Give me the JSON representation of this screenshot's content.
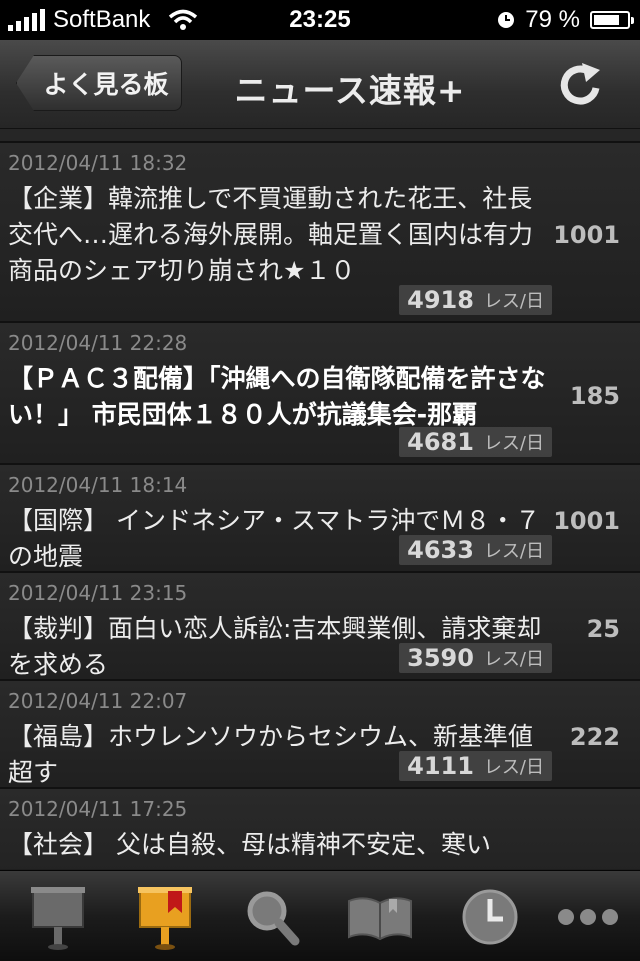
{
  "status_bar": {
    "carrier": "SoftBank",
    "time": "23:25",
    "battery": "79 %",
    "battery_level": 0.79
  },
  "nav": {
    "back_label": "よく見る板",
    "title": "ニュース速報+",
    "refresh_icon": "refresh-icon"
  },
  "threads": [
    {
      "date": "2012/04/11 18:32",
      "title": "【企業】韓流推しで不買運動された花王、社長交代へ…遅れる海外展開。軸足置く国内は有力商品のシェア切り崩され★１０",
      "rate": "4918",
      "count": "1001",
      "bold": false
    },
    {
      "date": "2012/04/11 22:28",
      "title": "【ＰＡＣ３配備】「沖縄への自衛隊配備を許さない！」 市民団体１８０人が抗議集会-那覇",
      "rate": "4681",
      "count": "185",
      "bold": true
    },
    {
      "date": "2012/04/11 18:14",
      "title": "【国際】 インドネシア・スマトラ沖でＭ８・７の地震",
      "rate": "4633",
      "count": "1001",
      "bold": false
    },
    {
      "date": "2012/04/11 23:15",
      "title": "【裁判】面白い恋人訴訟:吉本興業側、請求棄却を求める",
      "rate": "3590",
      "count": "25",
      "bold": false
    },
    {
      "date": "2012/04/11 22:07",
      "title": "【福島】ホウレンソウからセシウム、新基準値超す",
      "rate": "4111",
      "count": "222",
      "bold": false
    },
    {
      "date": "2012/04/11 17:25",
      "title": "【社会】 父は自殺、母は精神不安定、寒い",
      "rate": "",
      "count": "",
      "bold": false
    }
  ],
  "rate_unit": "レス/日",
  "tabbar": {
    "tabs": [
      {
        "icon": "board-sign-icon",
        "selected": false
      },
      {
        "icon": "bookmark-board-icon",
        "selected": true
      },
      {
        "icon": "search-icon",
        "selected": false
      },
      {
        "icon": "book-icon",
        "selected": false
      },
      {
        "icon": "clock-icon",
        "selected": false
      },
      {
        "icon": "more-icon",
        "selected": false
      }
    ]
  },
  "colors": {
    "background": "#1e1e1e",
    "accent": "#e8a020"
  }
}
